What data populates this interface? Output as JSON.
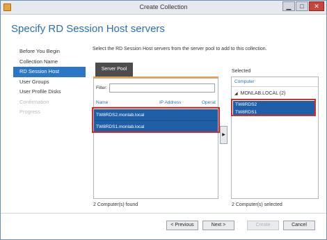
{
  "window": {
    "title": "Create Collection",
    "min_label": "▁",
    "max_label": "□",
    "close_label": "✕"
  },
  "page_title": "Specify RD Session Host servers",
  "nav": {
    "items": [
      {
        "label": "Before You Begin"
      },
      {
        "label": "Collection Name"
      },
      {
        "label": "RD Session Host"
      },
      {
        "label": "User Groups"
      },
      {
        "label": "User Profile Disks"
      },
      {
        "label": "Confirmation"
      },
      {
        "label": "Progress"
      }
    ]
  },
  "instructions": "Select the RD Session Host servers from the server pool to add to this collection.",
  "server_pool": {
    "tab_label": "Server Pool",
    "filter_label": "Filter:",
    "filter_value": "",
    "columns": [
      "Name",
      "IP Address",
      "Operat"
    ],
    "rows": [
      "TW8RDS2.monlab.local",
      "TW8RDS1.monlab.local"
    ],
    "count_text": "2 Computer(s) found"
  },
  "add_arrow": "▶",
  "selected": {
    "label": "Selected",
    "column": "Computer",
    "group_arrow": "◢",
    "group": "MONLAB.LOCAL (2)",
    "rows": [
      "TW8RDS2",
      "TW8RDS1"
    ],
    "count_text": "2 Computer(s) selected"
  },
  "buttons": {
    "previous": "< Previous",
    "next": "Next >",
    "create": "Create",
    "cancel": "Cancel"
  },
  "colors": {
    "accent": "#2b77c5",
    "title_blue": "#2a6fb8",
    "tab_underline": "#e8a33a",
    "selection": "#1f5fa8",
    "highlight_box": "#d42b2b"
  }
}
